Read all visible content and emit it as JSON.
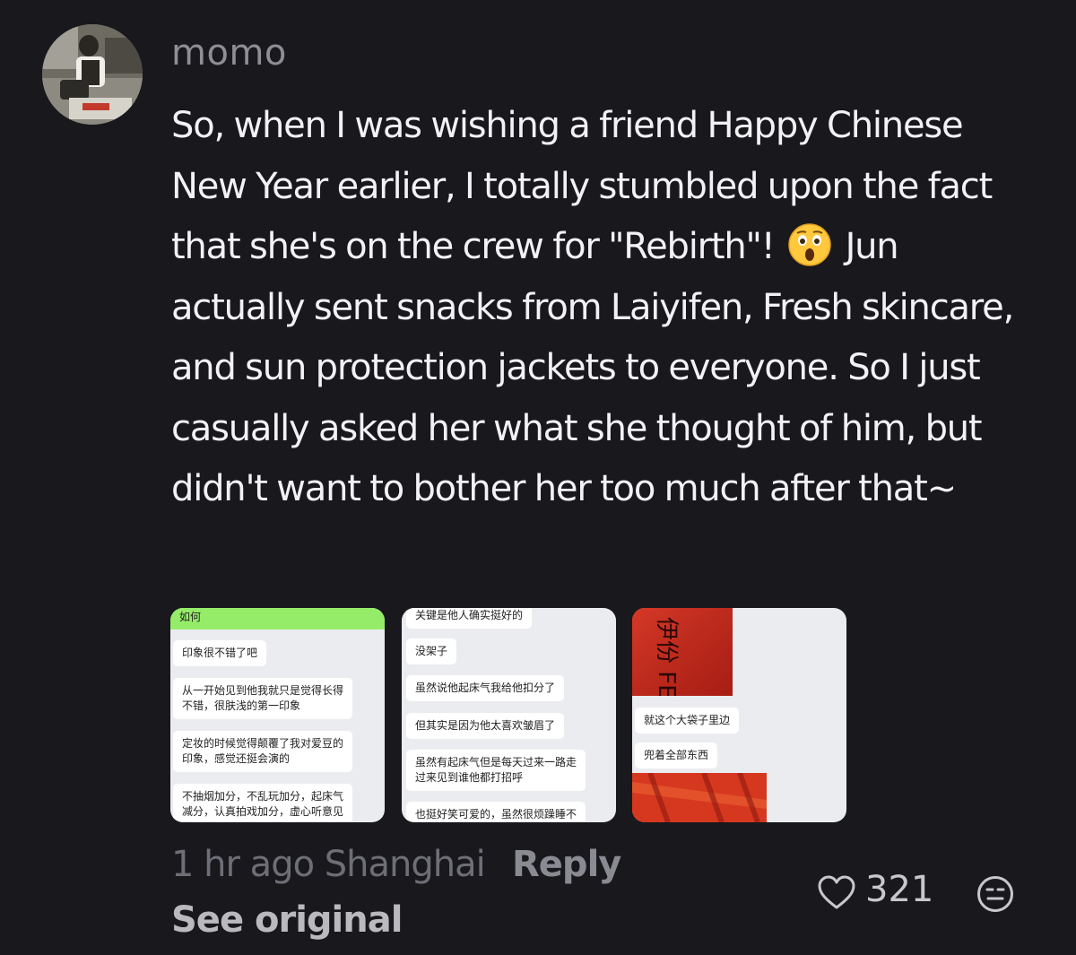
{
  "comment": {
    "username": "momo",
    "text_part1": "So, when I was wishing a friend Happy Chinese New Year earlier, I totally stumbled upon the fact that she's on the crew for \"Rebirth\"!",
    "text_emoji": "astonished-face-emoji",
    "text_part2": "Jun actually sent snacks from Laiyifen, Fresh skincare, and sun protection jackets to everyone. So I just casually asked her what she thought of him, but didn't want to bother her too much after that~",
    "time_location": "1 hr ago Shanghai",
    "reply_label": "Reply",
    "see_original_label": "See original",
    "like_count": "321",
    "icons": {
      "like": "heart-outline-icon",
      "react": "emoji-reaction-icon"
    }
  },
  "attachments": {
    "image1": {
      "top_bubble": "如何",
      "bubbles": [
        "印象很不错了吧",
        "从一开始见到他我就只是觉得长得\n不错，很肤浅的第一印象",
        "定妆的时候觉得颠覆了我对爱豆的\n印象，感觉还挺会演的",
        "不抽烟加分，不乱玩加分，起床气\n减分，认真拍戏加分，虚心听意见"
      ]
    },
    "image2": {
      "bubbles": [
        "关键是他人确实挺好的",
        "没架子",
        "虽然说他起床气我给他扣分了",
        "但其实是因为他太喜欢皱眉了",
        "虽然有起床气但是每天过来一路走\n过来见到谁他都打招呼",
        "也挺好笑可爱的，虽然很烦躁睡不"
      ]
    },
    "image3": {
      "photo_text": "伊份 FEN",
      "bubbles": [
        "就这个大袋子里边",
        "兜着全部东西"
      ]
    }
  },
  "colors": {
    "background": "#18181d",
    "text": "#f2f2f4",
    "muted": "#6e6e76",
    "wechat_green": "#95ec69"
  }
}
